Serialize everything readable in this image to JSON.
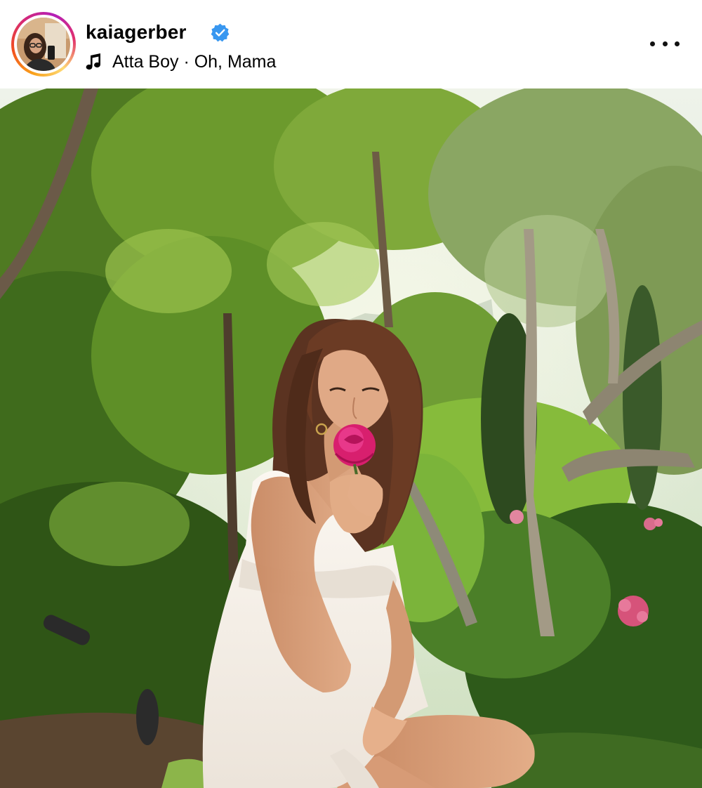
{
  "post": {
    "username": "kaiagerber",
    "verified": true,
    "audio": "Atta Boy · Oh, Mama"
  },
  "icons": {
    "verified": "verified-badge-icon",
    "music": "music-note-icon",
    "more": "more-options-icon"
  },
  "colors": {
    "verified_blue": "#3897f0",
    "text": "#000000",
    "background": "#ffffff"
  }
}
